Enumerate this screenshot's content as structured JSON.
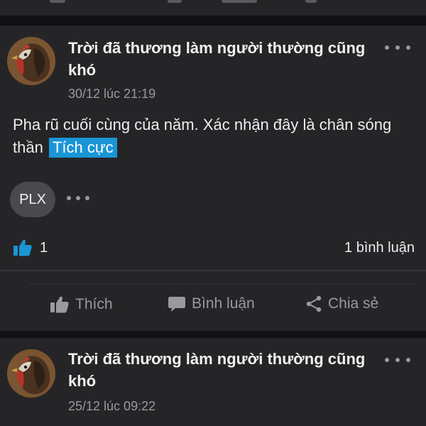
{
  "feed": {
    "posts": [
      {
        "author": "Trời đã thương làm người thường cũng khó",
        "timestamp": "30/12 lúc 21:19",
        "body": "Pha rũ cuối cùng của năm. Xác nhận đây là chân sóng thần",
        "sentiment_tag": "Tích cực",
        "ticker": "PLX",
        "like_count": "1",
        "comment_count": "1 bình luận",
        "actions": {
          "like": "Thích",
          "comment": "Bình luận",
          "share": "Chia sẻ"
        }
      },
      {
        "author": "Trời đã thương làm người thường cũng khó",
        "timestamp": "25/12 lúc 09:22"
      }
    ]
  },
  "colors": {
    "background": "#18181a",
    "card": "#252527",
    "accent": "#1a95d6",
    "muted": "#9a9a9e"
  },
  "icons": [
    "more-icon",
    "thumbs-up-icon",
    "comment-icon",
    "share-icon",
    "avatar-rooster"
  ]
}
